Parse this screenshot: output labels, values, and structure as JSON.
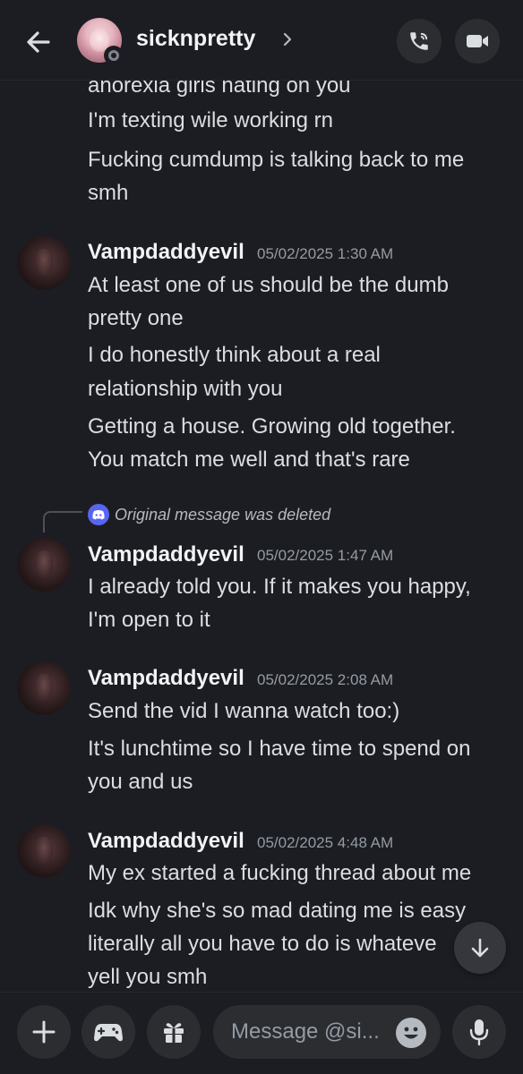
{
  "header": {
    "name": "sicknpretty",
    "icons": [
      "back-arrow-icon",
      "phone-icon",
      "video-camera-icon",
      "chevron-right-icon"
    ]
  },
  "messages": {
    "continuation_lines": [
      "anorexia girls hating on you",
      "I'm texting wile working rn",
      "Fucking cumdump is talking back to me",
      "smh"
    ],
    "groups": [
      {
        "author": "Vampdaddyevil",
        "timestamp": "05/02/2025 1:30 AM",
        "lines": [
          "At least one of us should be the dumb",
          "pretty one",
          "I do honestly think about a real",
          "relationship with you",
          "Getting a house. Growing old together.",
          "You match me well and that's rare"
        ]
      },
      {
        "reply_notice": "Original message was deleted",
        "author": "Vampdaddyevil",
        "timestamp": "05/02/2025 1:47 AM",
        "lines": [
          "I already told you. If it makes you happy,",
          "I'm open to it"
        ]
      },
      {
        "author": "Vampdaddyevil",
        "timestamp": "05/02/2025 2:08 AM",
        "lines": [
          "Send the vid I wanna watch too:)",
          "It's lunchtime so I have time to spend on",
          "you and us"
        ]
      },
      {
        "author": "Vampdaddyevil",
        "timestamp": "05/02/2025 4:48 AM",
        "lines": [
          "My ex started a fucking thread about me",
          "Idk why she's so mad dating me is easy",
          "literally all you have to do is whateve",
          "yell you smh"
        ]
      }
    ]
  },
  "composer": {
    "placeholder": "Message @si...",
    "icons": [
      "plus-icon",
      "gamepad-icon",
      "gift-icon",
      "emoji-icon",
      "microphone-icon"
    ]
  },
  "colors": {
    "background": "#1c1d22",
    "surface": "#2b2d31",
    "text": "#dbdee1",
    "muted": "#949ba4",
    "blurple": "#5865f2"
  }
}
